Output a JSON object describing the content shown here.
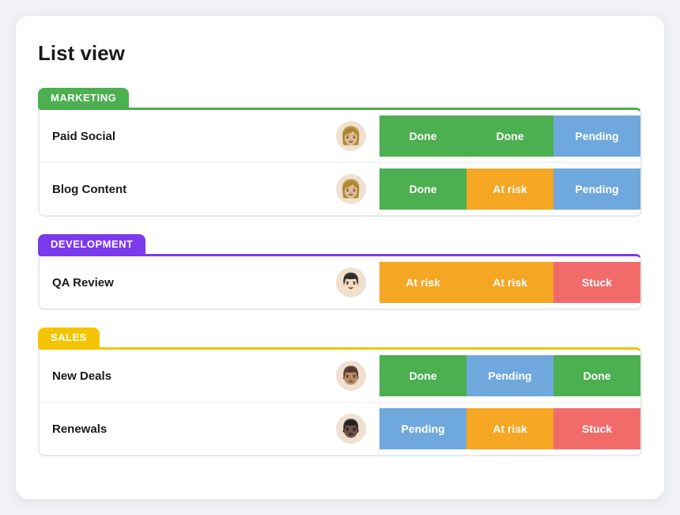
{
  "page": {
    "title": "List view"
  },
  "groups": [
    {
      "id": "marketing",
      "label": "MARKETING",
      "colorClass": "marketing",
      "rows": [
        {
          "name": "Paid Social",
          "avatar": "👩",
          "statuses": [
            {
              "label": "Done",
              "class": "done"
            },
            {
              "label": "Done",
              "class": "done"
            },
            {
              "label": "Pending",
              "class": "pending"
            }
          ]
        },
        {
          "name": "Blog Content",
          "avatar": "👩",
          "statuses": [
            {
              "label": "Done",
              "class": "done"
            },
            {
              "label": "At risk",
              "class": "at-risk"
            },
            {
              "label": "Pending",
              "class": "pending"
            }
          ]
        }
      ]
    },
    {
      "id": "development",
      "label": "DEVELOPMENT",
      "colorClass": "development",
      "rows": [
        {
          "name": "QA Review",
          "avatar": "👨",
          "statuses": [
            {
              "label": "At risk",
              "class": "at-risk"
            },
            {
              "label": "At risk",
              "class": "at-risk"
            },
            {
              "label": "Stuck",
              "class": "stuck"
            }
          ]
        }
      ]
    },
    {
      "id": "sales",
      "label": "SALES",
      "colorClass": "sales",
      "rows": [
        {
          "name": "New Deals",
          "avatar": "👨",
          "statuses": [
            {
              "label": "Done",
              "class": "done"
            },
            {
              "label": "Pending",
              "class": "pending"
            },
            {
              "label": "Done",
              "class": "done"
            }
          ]
        },
        {
          "name": "Renewals",
          "avatar": "👨",
          "statuses": [
            {
              "label": "Pending",
              "class": "pending"
            },
            {
              "label": "At risk",
              "class": "at-risk"
            },
            {
              "label": "Stuck",
              "class": "stuck"
            }
          ]
        }
      ]
    }
  ]
}
